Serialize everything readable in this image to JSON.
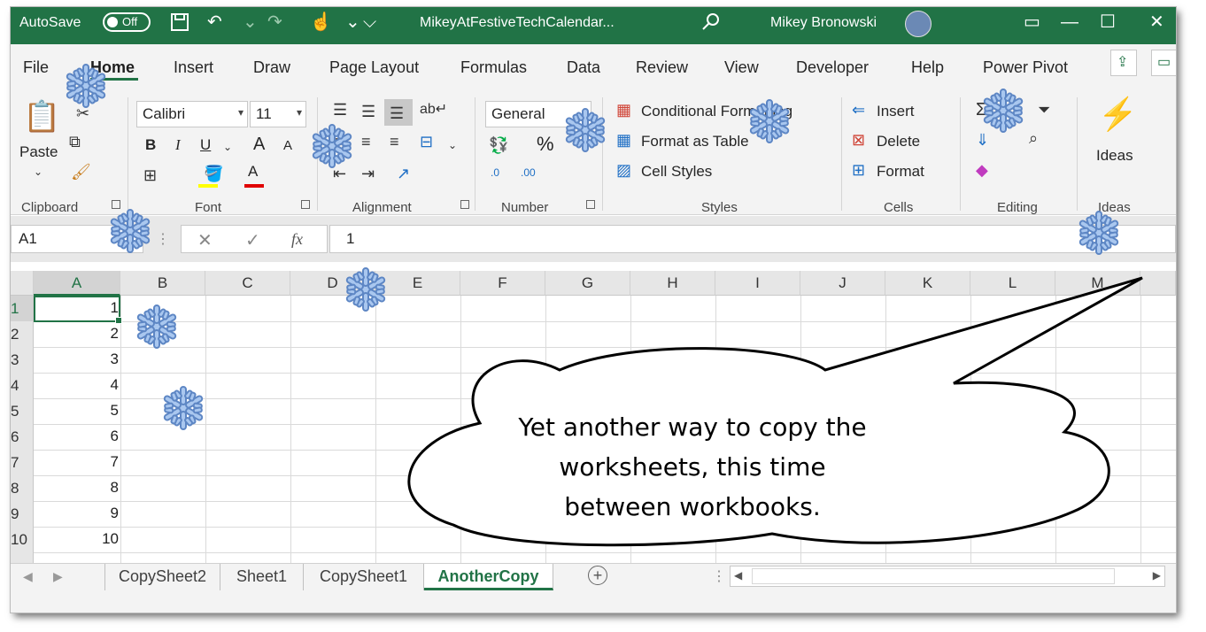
{
  "titlebar": {
    "autosave_label": "AutoSave",
    "autosave_state": "Off",
    "file_name": "MikeyAtFestiveTechCalendar...",
    "user_name": "Mikey Bronowski"
  },
  "menu": [
    "File",
    "Home",
    "Insert",
    "Draw",
    "Page Layout",
    "Formulas",
    "Data",
    "Review",
    "View",
    "Developer",
    "Help",
    "Power Pivot"
  ],
  "ribbon": {
    "clipboard": {
      "paste": "Paste",
      "group": "Clipboard"
    },
    "font": {
      "name": "Calibri",
      "size": "11",
      "bold": "B",
      "italic": "I",
      "underline": "U",
      "grow": "A",
      "shrink": "A",
      "color": "A",
      "group": "Font"
    },
    "alignment": {
      "group": "Alignment"
    },
    "number": {
      "format": "General",
      "percent": "%",
      "group": "Number",
      "inc": ".00",
      "dec": ".0"
    },
    "styles": {
      "conditional": "Conditional Formatting",
      "table": "Format as Table",
      "cell": "Cell Styles",
      "group": "Styles"
    },
    "cells": {
      "insert": "Insert",
      "delete": "Delete",
      "format": "Format",
      "group": "Cells"
    },
    "editing": {
      "group": "Editing"
    },
    "ideas": {
      "label": "Ideas",
      "group": "Ideas"
    }
  },
  "formula_bar": {
    "name_box": "A1",
    "fx": "fx",
    "value": "1"
  },
  "columns": [
    "A",
    "B",
    "C",
    "D",
    "E",
    "F",
    "G",
    "H",
    "I",
    "J",
    "K",
    "L",
    "M"
  ],
  "rows": [
    "1",
    "2",
    "3",
    "4",
    "5",
    "6",
    "7",
    "8",
    "9",
    "10"
  ],
  "column_a_values": [
    "1",
    "2",
    "3",
    "4",
    "5",
    "6",
    "7",
    "8",
    "9",
    "10"
  ],
  "sheet_tabs": [
    "CopySheet2",
    "Sheet1",
    "CopySheet1",
    "AnotherCopy"
  ],
  "active_sheet": "AnotherCopy",
  "callout": {
    "text": "Yet another way to copy the worksheets, this time between workbooks."
  },
  "colors": {
    "excel_green": "#217346",
    "flake": "#8fb4e6"
  }
}
